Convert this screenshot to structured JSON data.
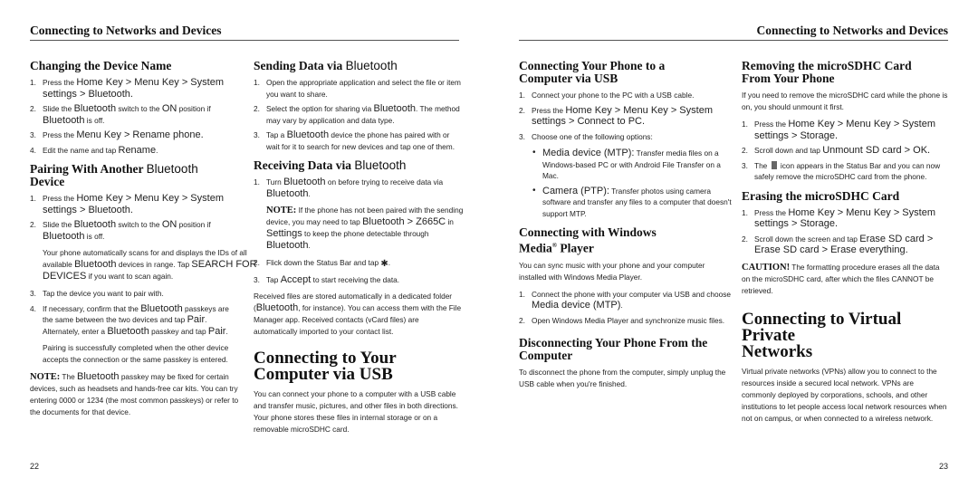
{
  "running_head": "Connecting to Networks and Devices",
  "left_page": {
    "page_number": "22",
    "col1": {
      "changing_name": {
        "title": "Changing the Device Name",
        "steps": [
          {
            "n": "1.",
            "pre": "Press the ",
            "big": "Home Key > Menu Key > System settings > Bluetooth."
          },
          {
            "n": "2.",
            "pre": "Slide the ",
            "big1": "Bluetooth",
            "mid": " switch to the ",
            "big2": "ON",
            "mid2": " position if ",
            "big3": "Bluetooth",
            "post": " is off."
          },
          {
            "n": "3.",
            "pre": "Press the ",
            "big": "Menu Key > Rename phone."
          },
          {
            "n": "4.",
            "pre": "Edit the name and tap ",
            "big": "Rename",
            "post": "."
          }
        ]
      },
      "pairing": {
        "title_serif": "Pairing With Another ",
        "title_sans": "Bluetooth",
        "title_serif2": "Device",
        "steps": [
          {
            "n": "1.",
            "pre": "Press the ",
            "big": "Home Key > Menu Key > System settings > Bluetooth."
          },
          {
            "n": "2.",
            "pre": "Slide the ",
            "big1": "Bluetooth",
            "mid": " switch to the ",
            "big2": "ON",
            "mid2": " position if ",
            "big3": "Bluetooth",
            "post": " is off."
          }
        ],
        "scan_note_pre": "Your phone automatically scans for and displays the IDs of all available ",
        "scan_note_big": "Bluetooth",
        "scan_note_mid": " devices in range. Tap ",
        "scan_note_big2": "SEARCH FOR DEVICES",
        "scan_note_post": " if you want to scan again.",
        "step3": {
          "n": "3.",
          "text": "Tap the device you want to pair with."
        },
        "step4": {
          "n": "4.",
          "pre": "If necessary, confirm that the ",
          "big1": "Bluetooth",
          "mid": " passkeys are the same between the two devices and tap ",
          "big2": "Pair",
          "mid2": ". Alternately, enter a ",
          "big3": "Bluetooth",
          "mid3": " passkey and tap ",
          "big4": "Pair",
          "post": "."
        },
        "pair_success": "Pairing is successfully completed when the other device accepts the connection or the same passkey is entered.",
        "note_label": "NOTE:",
        "note_pre": " The ",
        "note_big": "Bluetooth",
        "note_post": " passkey may be fixed for certain devices, such as headsets and hands-free car kits. You can try entering 0000 or 1234 (the most common passkeys) or refer to the documents for that device."
      }
    },
    "col2": {
      "sending": {
        "title_serif": "Sending Data via ",
        "title_sans": "Bluetooth",
        "steps": [
          {
            "n": "1.",
            "text": "Open the appropriate application and select the file or item you want to share."
          },
          {
            "n": "2.",
            "pre": "Select the option for sharing via ",
            "big": "Bluetooth",
            "post": ". The method may vary by application and data type."
          },
          {
            "n": "3.",
            "pre": "Tap a ",
            "big": "Bluetooth",
            "post": " device the phone has paired with or wait for it to search for new devices and tap one of them."
          }
        ]
      },
      "receiving": {
        "title_serif": "Receiving Data via ",
        "title_sans": "Bluetooth",
        "step1": {
          "n": "1.",
          "pre": "Turn ",
          "big": "Bluetooth",
          "mid": " on before trying to receive data via ",
          "big2": "Bluetooth",
          "post": "."
        },
        "note_label": "NOTE:",
        "note_pre": " If the phone has not been paired with the sending device, you may need to tap ",
        "note_big": "Bluetooth > Z665C",
        "note_mid": " in ",
        "note_big2": "Settings",
        "note_mid2": " to keep the phone detectable through ",
        "note_big3": "Bluetooth",
        "note_post": ".",
        "step2": {
          "n": "2.",
          "pre": "Flick down the Status Bar and tap ",
          "post": "."
        },
        "step3": {
          "n": "3.",
          "pre": "Tap ",
          "big": "Accept",
          "post": " to start receiving the data."
        },
        "received_files_pre": "Received files are stored automatically in a dedicated folder (",
        "received_files_big": "Bluetooth",
        "received_files_post": ", for instance). You can access them with the File Manager app. Received contacts (vCard files) are automatically imported to your contact list."
      },
      "usb_section": {
        "title_line1": "Connecting to Your",
        "title_line2": "Computer via USB",
        "body": "You can connect your phone to a computer with a USB cable and transfer music, pictures, and other files in both directions. Your phone stores these files in internal storage or on a removable microSDHC card."
      }
    }
  },
  "right_page": {
    "page_number": "23",
    "col1": {
      "connect_usb": {
        "title": "Connecting Your Phone to a Computer via USB",
        "step1": {
          "n": "1.",
          "text": "Connect your phone to the PC with a USB cable."
        },
        "step2": {
          "n": "2.",
          "pre": "Press the ",
          "big": "Home Key > Menu Key > System settings > Connect to PC."
        },
        "step3": {
          "n": "3.",
          "text": "Choose one of the following options:"
        },
        "options": [
          {
            "big": "Media device (MTP):",
            "text": " Transfer media files on a Windows-based PC or with Android File Transfer on a Mac."
          },
          {
            "big": "Camera (PTP):",
            "text": " Transfer photos using camera software and transfer any files to a computer that doesn't support MTP."
          }
        ]
      },
      "wmp": {
        "title_pre": "Connecting with Windows Media",
        "title_sup": "®",
        "title_post": " Player",
        "intro": "You can sync music with your phone and your computer installed with Windows Media Player.",
        "step1": {
          "n": "1.",
          "pre": "Connect the phone with your computer via USB and choose ",
          "big": "Media device (MTP)",
          "post": "."
        },
        "step2": {
          "n": "2.",
          "text": "Open Windows Media Player and synchronize music files."
        }
      },
      "disconnect": {
        "title": "Disconnecting Your Phone From the Computer",
        "body": "To disconnect the phone from the computer, simply unplug the USB cable when you're finished."
      }
    },
    "col2": {
      "removing": {
        "title": "Removing the microSDHC Card From Your Phone",
        "intro": "If you need to remove the microSDHC card while the phone is on, you should unmount it first.",
        "step1": {
          "n": "1.",
          "pre": "Press the ",
          "big": "Home Key > Menu Key > System settings > Storage."
        },
        "step2": {
          "n": "2.",
          "pre": "Scroll down and tap ",
          "big": "Unmount SD card > OK."
        },
        "step3": {
          "n": "3.",
          "pre": "The ",
          "post": " icon appears in the Status Bar and you can now safely remove the microSDHC card from the phone."
        }
      },
      "erasing": {
        "title": "Erasing the microSDHC Card",
        "step1": {
          "n": "1.",
          "pre": "Press the ",
          "big": "Home Key > Menu Key > System settings > Storage."
        },
        "step2": {
          "n": "2.",
          "pre": "Scroll down the screen and tap ",
          "big": "Erase SD card > Erase SD card > Erase everything."
        },
        "caution_label": "CAUTION!",
        "caution_text": " The formatting procedure erases all the data on the microSDHC card, after which the files CANNOT be retrieved."
      },
      "vpn": {
        "title_line1": "Connecting to Virtual Private",
        "title_line2": "Networks",
        "body": "Virtual private networks (VPNs) allow you to connect to the resources inside a secured local network. VPNs are commonly deployed by corporations, schools, and other institutions to let people access local network resources when not on campus, or when connected to a wireless network."
      }
    }
  }
}
